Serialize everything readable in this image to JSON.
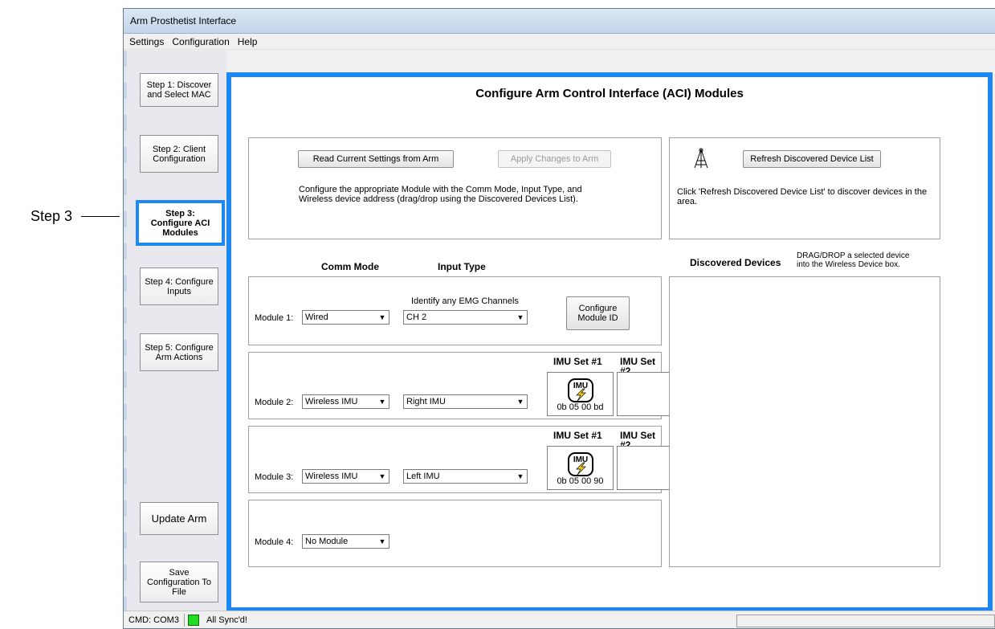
{
  "callout": {
    "label": "Step 3"
  },
  "window": {
    "title": "Arm Prosthetist Interface"
  },
  "menu": [
    "Settings",
    "Configuration",
    "Help"
  ],
  "sidebar": {
    "steps": [
      {
        "label": "Step 1: Discover\nand Select MAC"
      },
      {
        "label": "Step 2: Client\nConfiguration"
      },
      {
        "label": "Step 3:\nConfigure ACI\nModules"
      },
      {
        "label": "Step 4: Configure\nInputs"
      },
      {
        "label": "Step 5: Configure\nArm Actions"
      }
    ],
    "update_label": "Update Arm",
    "save_label": "Save\nConfiguration To\nFile"
  },
  "main": {
    "title": "Configure Arm Control Interface (ACI) Modules",
    "read_button": "Read Current Settings from Arm",
    "apply_button": "Apply Changes to Arm",
    "instructions": "Configure the appropriate Module with the Comm Mode, Input Type, and\nWireless device address (drag/drop using the Discovered Devices List).",
    "refresh_button": "Refresh Discovered Device List",
    "refresh_instructions": "Click 'Refresh Discovered Device List' to discover devices in the\narea.",
    "comm_mode_header": "Comm Mode",
    "input_type_header": "Input Type",
    "discovered_header": "Discovered Devices",
    "discovered_hint": "DRAG/DROP a selected device\ninto the Wireless Device box.",
    "imu_set1": "IMU Set #1",
    "imu_set2": "IMU Set #2",
    "imu_icon_text": "IMU"
  },
  "modules": [
    {
      "label": "Module 1:",
      "comm": "Wired",
      "emg_label": "Identify any EMG Channels",
      "input": "CH 2",
      "config_button": "Configure\nModule ID"
    },
    {
      "label": "Module 2:",
      "comm": "Wireless IMU",
      "input": "Right IMU",
      "imu_addr": "0b 05 00 bd"
    },
    {
      "label": "Module 3:",
      "comm": "Wireless IMU",
      "input": "Left IMU",
      "imu_addr": "0b 05 00 90"
    },
    {
      "label": "Module 4:",
      "comm": "No Module"
    }
  ],
  "status": {
    "cmd": "CMD: COM3",
    "sync": "All Sync'd!",
    "led_color": "#22dd22"
  },
  "colors": {
    "accent": "#1e87f0"
  }
}
